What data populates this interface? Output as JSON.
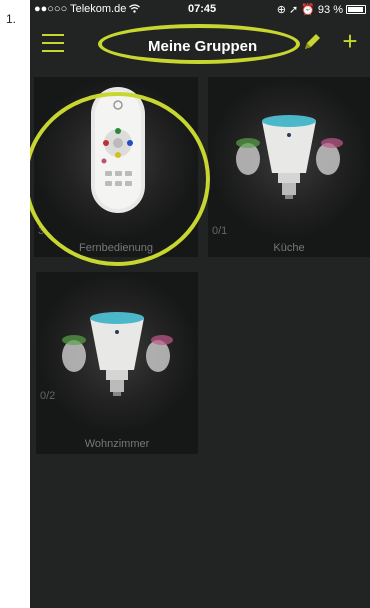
{
  "step_label": "1.",
  "status_bar": {
    "carrier": "●●○○○ Telekom.de ",
    "time": "07:45",
    "battery": "93 %"
  },
  "nav": {
    "title": "Meine Gruppen",
    "accent_color": "#c8d630"
  },
  "groups": [
    {
      "name": "Fernbedienung",
      "count": "3"
    },
    {
      "name": "Küche",
      "count": "0/1"
    },
    {
      "name": "Wohnzimmer",
      "count": "0/2"
    }
  ],
  "icons": {
    "menu": "hamburger-menu-icon",
    "edit": "pencil-icon",
    "add": "plus-icon",
    "wifi": "wifi-icon",
    "battery": "battery-icon"
  }
}
